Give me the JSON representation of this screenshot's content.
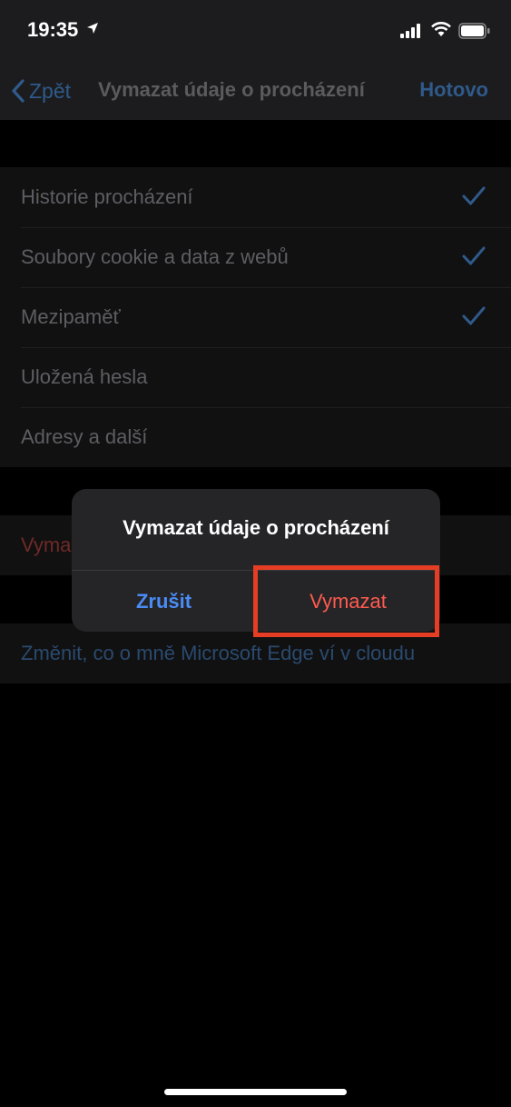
{
  "status_bar": {
    "time": "19:35",
    "location_icon": "location-arrow-icon",
    "signal_icon": "cellular-signal-icon",
    "wifi_icon": "wifi-icon",
    "battery_icon": "battery-icon"
  },
  "nav": {
    "back_label": "Zpět",
    "title": "Vymazat údaje o procházení",
    "done_label": "Hotovo"
  },
  "data_types": [
    {
      "label": "Historie procházení",
      "checked": true
    },
    {
      "label": "Soubory cookie a data z webů",
      "checked": true
    },
    {
      "label": "Mezipaměť",
      "checked": true
    },
    {
      "label": "Uložená hesla",
      "checked": false
    },
    {
      "label": "Adresy a další",
      "checked": false
    }
  ],
  "clear_action_label": "Vyma",
  "cloud_link_label": "Změnit, co o mně Microsoft Edge ví v cloudu",
  "dialog": {
    "title": "Vymazat údaje o procházení",
    "cancel_label": "Zrušit",
    "confirm_label": "Vymazat"
  },
  "colors": {
    "accent": "#4a8bf5",
    "destructive": "#ff5a4f",
    "highlight": "#e53e24"
  }
}
